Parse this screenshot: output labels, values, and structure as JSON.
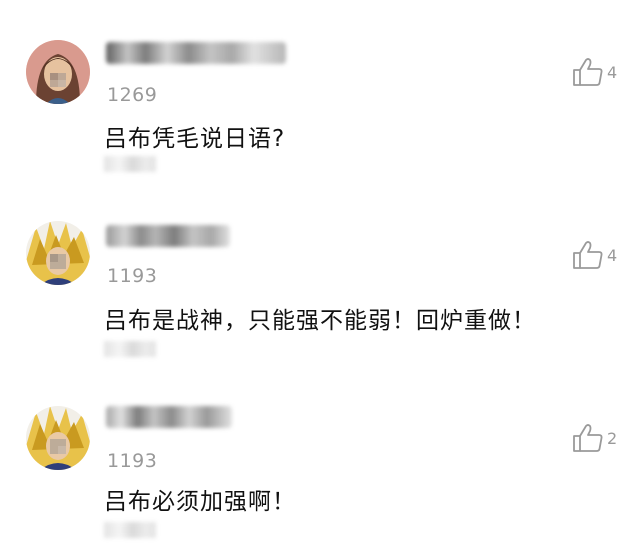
{
  "comments": [
    {
      "username_display": "",
      "user_id": "1269",
      "text": "吕布凭毛说日语?",
      "likes": "4",
      "avatar": "female-character-avatar",
      "like_icon": "thumbs-up-icon"
    },
    {
      "username_display": "",
      "user_id": "1193",
      "text": "吕布是战神，只能强不能弱！回炉重做！",
      "likes": "4",
      "avatar": "spiky-hair-character-avatar",
      "like_icon": "thumbs-up-icon"
    },
    {
      "username_display": "",
      "user_id": "1193",
      "text": "吕布必须加强啊！",
      "likes": "2",
      "avatar": "spiky-hair-character-avatar",
      "like_icon": "thumbs-up-icon"
    }
  ],
  "colors": {
    "secondary_text": "#999999",
    "primary_text": "#111111",
    "icon": "#9a9a9a"
  }
}
